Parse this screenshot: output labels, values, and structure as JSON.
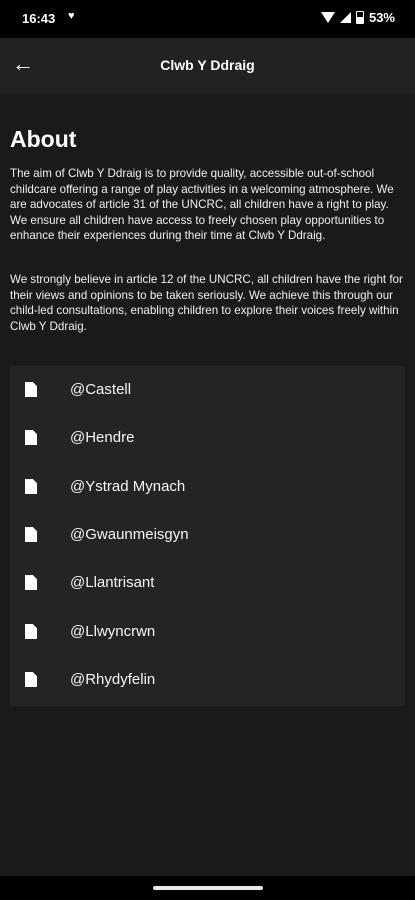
{
  "status": {
    "time": "16:43",
    "battery": "53%"
  },
  "header": {
    "title": "Clwb Y Ddraig"
  },
  "about": {
    "heading": "About",
    "paragraph1": "The aim of Clwb Y Ddraig is to provide quality, accessible out-of-school childcare offering a range of play activities in a welcoming atmosphere.  We are advocates of article 31 of the UNCRC, all children have a right to play. We ensure all children have access to freely chosen play opportunities to enhance their experiences during their time at Clwb Y Ddraig.",
    "paragraph2": "We strongly believe in article 12 of the UNCRC, all children have the right for their views and opinions to be taken seriously. We achieve this through our child-led consultations, enabling children to explore their voices freely within Clwb Y Ddraig."
  },
  "locations": [
    {
      "label": "@Castell",
      "icon": "document-icon"
    },
    {
      "label": "@Hendre",
      "icon": "document-icon"
    },
    {
      "label": "@Ystrad Mynach",
      "icon": "document-icon"
    },
    {
      "label": "@Gwaunmeisgyn",
      "icon": "document-icon"
    },
    {
      "label": "@Llantrisant",
      "icon": "document-icon"
    },
    {
      "label": "@Llwyncrwn",
      "icon": "document-icon"
    },
    {
      "label": "@Rhydyfelin",
      "icon": "document-icon"
    }
  ],
  "colors": {
    "background": "#1a1a1a",
    "app_bar": "#222222",
    "card": "#242424",
    "text": "#ffffff"
  }
}
